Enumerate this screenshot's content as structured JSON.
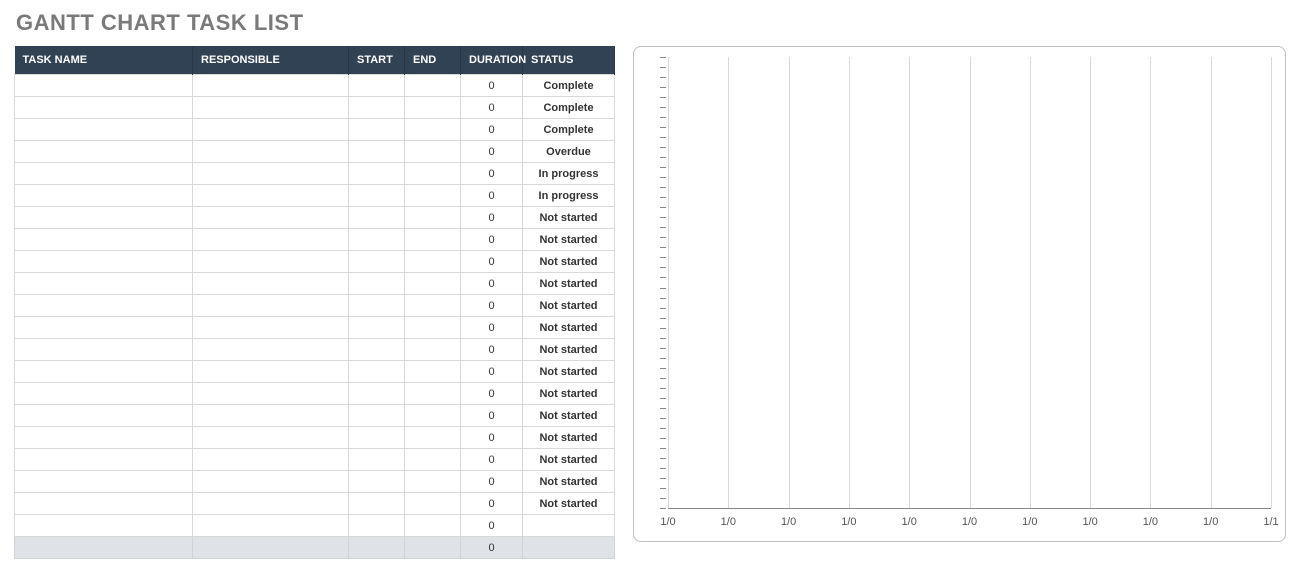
{
  "title": "GANTT CHART TASK LIST",
  "columns": {
    "task": "TASK NAME",
    "responsible": "RESPONSIBLE",
    "start": "START",
    "end": "END",
    "duration": "DURATION",
    "status": "STATUS"
  },
  "rows": [
    {
      "task": "",
      "responsible": "",
      "start": "",
      "end": "",
      "duration": "0",
      "status": "Complete"
    },
    {
      "task": "",
      "responsible": "",
      "start": "",
      "end": "",
      "duration": "0",
      "status": "Complete"
    },
    {
      "task": "",
      "responsible": "",
      "start": "",
      "end": "",
      "duration": "0",
      "status": "Complete"
    },
    {
      "task": "",
      "responsible": "",
      "start": "",
      "end": "",
      "duration": "0",
      "status": "Overdue"
    },
    {
      "task": "",
      "responsible": "",
      "start": "",
      "end": "",
      "duration": "0",
      "status": "In progress"
    },
    {
      "task": "",
      "responsible": "",
      "start": "",
      "end": "",
      "duration": "0",
      "status": "In progress"
    },
    {
      "task": "",
      "responsible": "",
      "start": "",
      "end": "",
      "duration": "0",
      "status": "Not started"
    },
    {
      "task": "",
      "responsible": "",
      "start": "",
      "end": "",
      "duration": "0",
      "status": "Not started"
    },
    {
      "task": "",
      "responsible": "",
      "start": "",
      "end": "",
      "duration": "0",
      "status": "Not started"
    },
    {
      "task": "",
      "responsible": "",
      "start": "",
      "end": "",
      "duration": "0",
      "status": "Not started"
    },
    {
      "task": "",
      "responsible": "",
      "start": "",
      "end": "",
      "duration": "0",
      "status": "Not started"
    },
    {
      "task": "",
      "responsible": "",
      "start": "",
      "end": "",
      "duration": "0",
      "status": "Not started"
    },
    {
      "task": "",
      "responsible": "",
      "start": "",
      "end": "",
      "duration": "0",
      "status": "Not started"
    },
    {
      "task": "",
      "responsible": "",
      "start": "",
      "end": "",
      "duration": "0",
      "status": "Not started"
    },
    {
      "task": "",
      "responsible": "",
      "start": "",
      "end": "",
      "duration": "0",
      "status": "Not started"
    },
    {
      "task": "",
      "responsible": "",
      "start": "",
      "end": "",
      "duration": "0",
      "status": "Not started"
    },
    {
      "task": "",
      "responsible": "",
      "start": "",
      "end": "",
      "duration": "0",
      "status": "Not started"
    },
    {
      "task": "",
      "responsible": "",
      "start": "",
      "end": "",
      "duration": "0",
      "status": "Not started"
    },
    {
      "task": "",
      "responsible": "",
      "start": "",
      "end": "",
      "duration": "0",
      "status": "Not started"
    },
    {
      "task": "",
      "responsible": "",
      "start": "",
      "end": "",
      "duration": "0",
      "status": "Not started"
    },
    {
      "task": "",
      "responsible": "",
      "start": "",
      "end": "",
      "duration": "0",
      "status": ""
    }
  ],
  "summary": {
    "task": "",
    "responsible": "",
    "start": "",
    "end": "",
    "duration": "0",
    "status": ""
  },
  "status_colors": {
    "Complete": "#1f8a3b",
    "Overdue": "#e07a1b",
    "In progress": "#e07a1b",
    "Not started": "#8a8a8a"
  },
  "chart_data": {
    "type": "bar",
    "title": "",
    "xlabel": "",
    "ylabel": "",
    "x_ticks": [
      "1/0",
      "1/0",
      "1/0",
      "1/0",
      "1/0",
      "1/0",
      "1/0",
      "1/0",
      "1/0",
      "1/0",
      "1/1"
    ],
    "y_tick_count": 45,
    "series": [],
    "xlim": [
      0,
      10
    ],
    "ylim": [
      0,
      45
    ]
  }
}
